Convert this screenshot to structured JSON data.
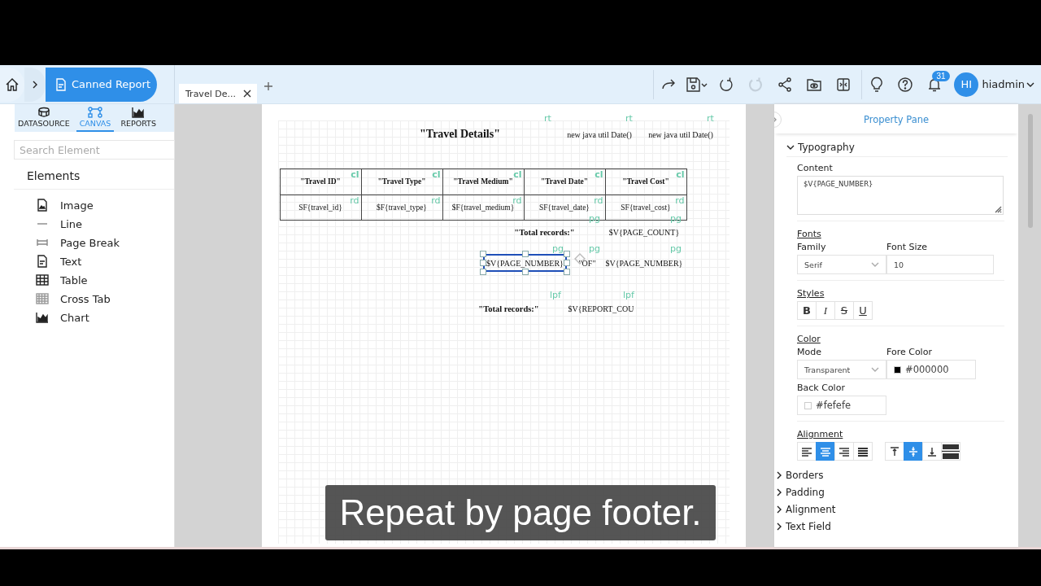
{
  "top_bar": {
    "breadcrumb": "Canned Report",
    "tab": {
      "label": "Travel De...",
      "selected": true
    },
    "toolbar": [
      {
        "kind": "redo",
        "disabled": false
      },
      {
        "kind": "save",
        "disabled": false
      },
      {
        "kind": "refresh",
        "disabled": false
      },
      {
        "kind": "refresh",
        "disabled": true
      },
      {
        "kind": "share",
        "disabled": false
      },
      {
        "kind": "folder",
        "disabled": false
      },
      {
        "kind": "split",
        "disabled": false
      },
      {
        "kind": "bulb",
        "disabled": false
      },
      {
        "kind": "help",
        "disabled": false
      },
      {
        "kind": "bell",
        "disabled": false
      }
    ],
    "notification_count": "31",
    "avatar": "HI",
    "user": "hiadmin"
  },
  "left_tabs": [
    {
      "label": "DATASOURCE",
      "kind": "datasource",
      "selected": false
    },
    {
      "label": "CANVAS",
      "kind": "canvas",
      "selected": true
    },
    {
      "label": "REPORTS",
      "kind": "reports",
      "selected": false
    }
  ],
  "search": {
    "placeholder": "Search Element"
  },
  "elements": {
    "title": "Elements",
    "items": [
      {
        "label": "Image",
        "kind": "image"
      },
      {
        "label": "Line",
        "kind": "line"
      },
      {
        "label": "Page Break",
        "kind": "pagebreak"
      },
      {
        "label": "Text",
        "kind": "text"
      },
      {
        "label": "Table",
        "kind": "table"
      },
      {
        "label": "Cross Tab",
        "kind": "crosstab"
      },
      {
        "label": "Chart",
        "kind": "chart"
      }
    ]
  },
  "report": {
    "header": [
      {
        "text": "\"Travel Details\"",
        "tag": "rt",
        "bold": true,
        "selected": false
      },
      {
        "text": "new java util Date()",
        "tag": "rt",
        "bold": false,
        "selected": false
      },
      {
        "text": "new java util Date()",
        "tag": "rt",
        "bold": false,
        "selected": false
      }
    ],
    "columns": [
      {
        "header": "\"Travel ID\"",
        "header_tag": "cl",
        "field": "SF{travel_id}",
        "field_tag": "rd"
      },
      {
        "header": "\"Travel Type\"",
        "header_tag": "cl",
        "field": "$F{travel_type}",
        "field_tag": "rd"
      },
      {
        "header": "\"Travel Medium\"",
        "header_tag": "cl",
        "field": "$F{travel_medium}",
        "field_tag": "rd"
      },
      {
        "header": "\"Travel Date\"",
        "header_tag": "cl",
        "field": "SF{travel_date}",
        "field_tag": "rd"
      },
      {
        "header": "\"Travel Cost\"",
        "header_tag": "cl",
        "field": "SF{travel_cost}",
        "field_tag": "rd"
      }
    ],
    "footer_rows": [
      [
        {
          "text": "\"Total records:\"",
          "tag": "pg",
          "bold": true,
          "selected": false
        },
        {
          "text": "$V{PAGE_COUNT}",
          "tag": "pg",
          "bold": false,
          "selected": false
        }
      ],
      [
        {
          "text": "$V{PAGE_NUMBER}",
          "tag": "pg",
          "bold": false,
          "selected": true
        },
        {
          "text": "\"OF\"",
          "tag": "pg",
          "bold": false,
          "selected": false
        },
        {
          "text": "$V{PAGE_NUMBER}",
          "tag": "pg",
          "bold": false,
          "selected": false
        }
      ],
      [
        {
          "text": "\"Total records:\"",
          "tag": "lpf",
          "bold": true,
          "selected": false
        },
        {
          "text": "$V{REPORT_COU",
          "tag": "lpf",
          "bold": false,
          "selected": false
        }
      ]
    ]
  },
  "property_pane": {
    "title": "Property Pane",
    "typography": {
      "label": "Typography",
      "expanded": true
    },
    "content": {
      "label": "Content",
      "value": "$V{PAGE_NUMBER}"
    },
    "fonts": {
      "label": "Fonts",
      "family_label": "Family",
      "family": "Serif",
      "size_label": "Font Size",
      "size": "10"
    },
    "styles": {
      "label": "Styles",
      "buttons": [
        {
          "label": "B",
          "kind": "bold"
        },
        {
          "label": "I",
          "kind": "italic"
        },
        {
          "label": "S",
          "kind": "strike"
        },
        {
          "label": "U",
          "kind": "underline"
        }
      ]
    },
    "color": {
      "label": "Color",
      "mode_label": "Mode",
      "mode": "Transparent",
      "fore_label": "Fore Color",
      "fore": "#000000",
      "back_label": "Back Color",
      "back": "#fefefe"
    },
    "alignment": {
      "label": "Alignment",
      "horizontal": [
        {
          "kind": "left",
          "selected": false
        },
        {
          "kind": "center",
          "selected": true
        },
        {
          "kind": "right",
          "selected": false
        },
        {
          "kind": "justify",
          "selected": false
        }
      ],
      "vertical": [
        {
          "kind": "top",
          "selected": false
        },
        {
          "kind": "middle",
          "selected": true
        },
        {
          "kind": "bottom",
          "selected": false
        },
        {
          "kind": "stretch",
          "selected": false
        }
      ]
    },
    "sections": [
      {
        "label": "Borders",
        "expanded": false
      },
      {
        "label": "Padding",
        "expanded": false
      },
      {
        "label": "Alignment",
        "expanded": false
      },
      {
        "label": "Text Field",
        "expanded": false
      }
    ]
  },
  "caption": "Repeat by page footer."
}
